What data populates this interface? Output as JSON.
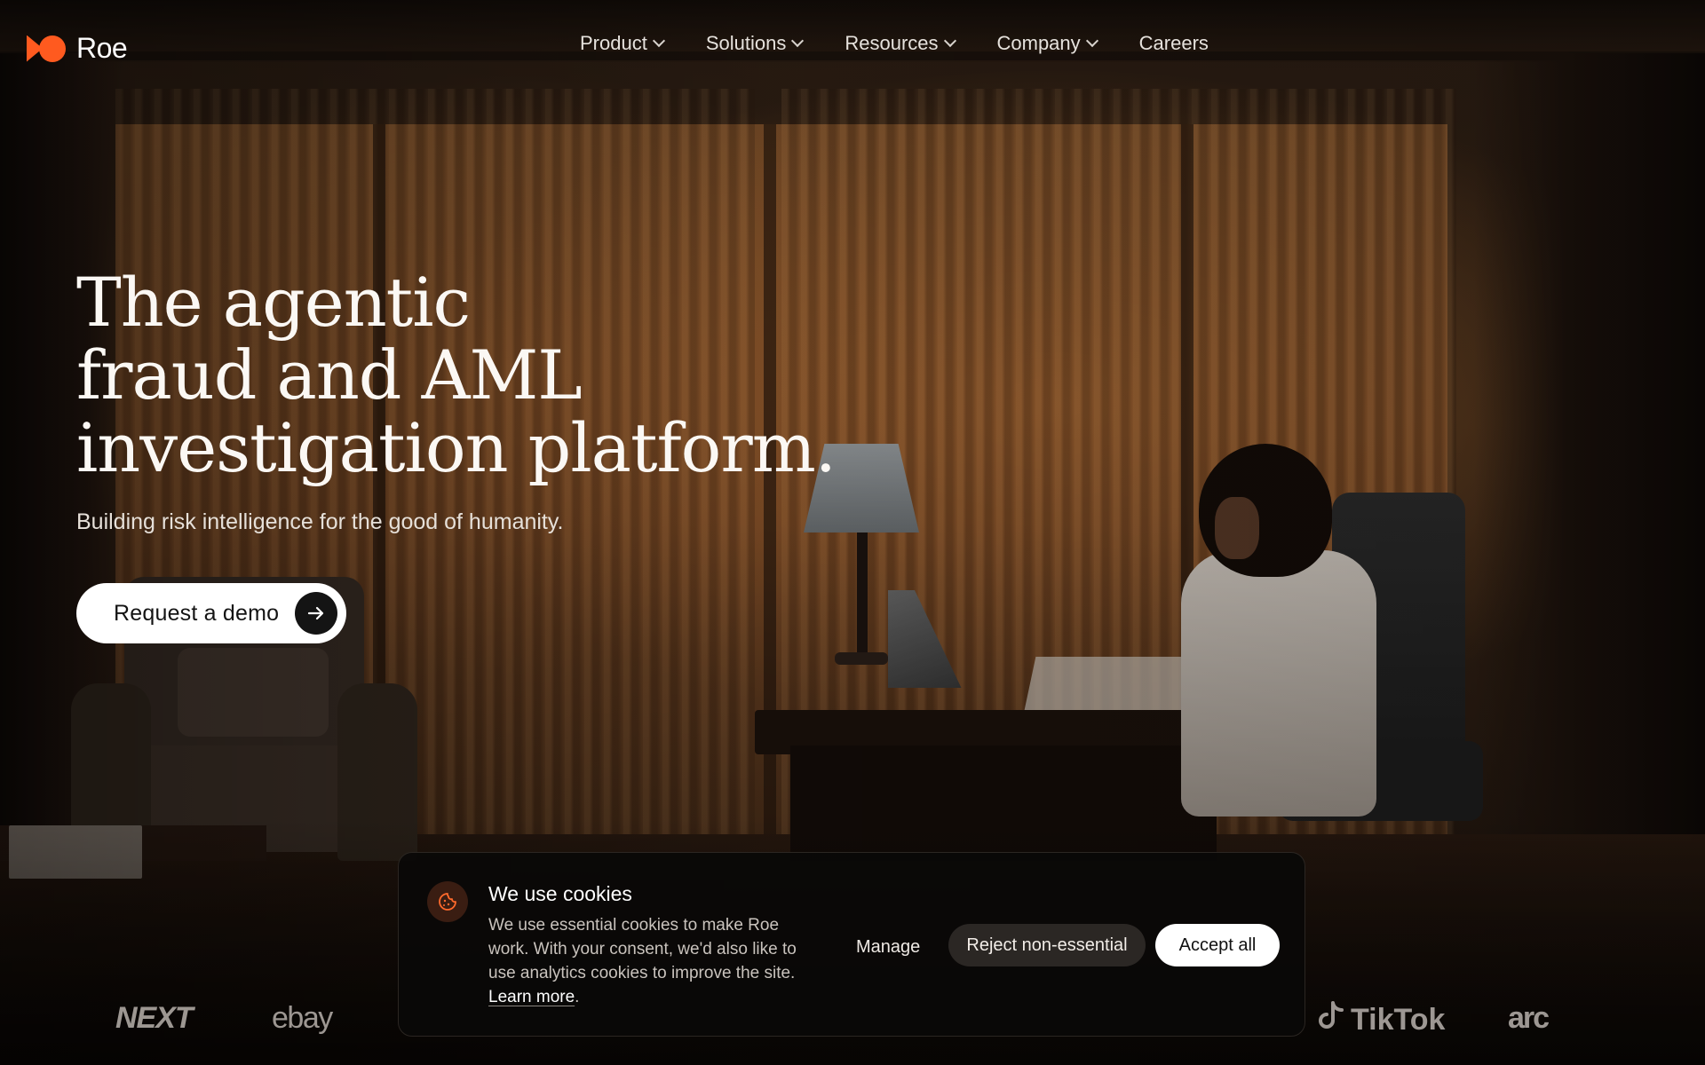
{
  "brand": {
    "name": "Roe",
    "accent_color": "#ff5a1f"
  },
  "nav": {
    "items": [
      {
        "label": "Product",
        "has_dropdown": true
      },
      {
        "label": "Solutions",
        "has_dropdown": true
      },
      {
        "label": "Resources",
        "has_dropdown": true
      },
      {
        "label": "Company",
        "has_dropdown": true
      },
      {
        "label": "Careers",
        "has_dropdown": false
      }
    ]
  },
  "hero": {
    "title_lines": [
      "The agentic",
      "fraud and AML",
      "investigation platform."
    ],
    "subtitle": "Building risk intelligence for the good of humanity.",
    "cta_label": "Request a demo",
    "cta_icon": "arrow-right-icon"
  },
  "customer_logos": [
    "NEXT",
    "ebay",
    "TikTok",
    "arc"
  ],
  "cookie_banner": {
    "icon": "cookie-icon",
    "title": "We use cookies",
    "body": "We use essential cookies to make Roe work. With your consent, we'd also like to use analytics cookies to improve the site.",
    "learn_more": "Learn more",
    "learn_more_suffix": ".",
    "manage_label": "Manage",
    "reject_label": "Reject non-essential",
    "accept_label": "Accept all"
  }
}
